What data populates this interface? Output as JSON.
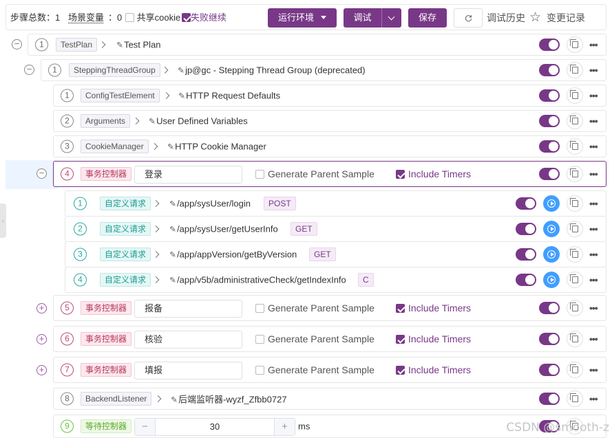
{
  "toolbar": {
    "steps_label": "步骤总数：1",
    "scene_vars_label": "场景变量",
    "scene_vars_count": "：0",
    "share_cookie_label": "共享cookie",
    "share_cookie_checked": false,
    "continue_on_fail_label": "失败继续",
    "continue_on_fail_checked": true,
    "run_env_label": "运行环境",
    "debug_label": "调试",
    "save_label": "保存",
    "refresh_icon": "refresh-icon",
    "debug_history_label": "调试历史",
    "change_log_label": "变更记录"
  },
  "accent_color": "#783887",
  "steps": {
    "test_plan": {
      "num": "1",
      "tag": "TestPlan",
      "name": "Test Plan"
    },
    "thread_group": {
      "num": "1",
      "tag": "SteppingThreadGroup",
      "name": "jp@gc - Stepping Thread Group (deprecated)"
    },
    "config": {
      "num": "1",
      "tag": "ConfigTestElement",
      "name": "HTTP Request Defaults"
    },
    "arguments": {
      "num": "2",
      "tag": "Arguments",
      "name": "User Defined Variables"
    },
    "cookie": {
      "num": "3",
      "tag": "CookieManager",
      "name": "HTTP Cookie Manager"
    },
    "tx_login": {
      "num": "4",
      "tag": "事务控制器",
      "name": "登录",
      "gen_parent_label": "Generate Parent Sample",
      "gen_parent_checked": false,
      "include_timers_label": "Include Timers",
      "include_timers_checked": true
    },
    "requests": [
      {
        "num": "1",
        "tag": "自定义请求",
        "path": "/app/sysUser/login",
        "method": "POST"
      },
      {
        "num": "2",
        "tag": "自定义请求",
        "path": "/app/sysUser/getUserInfo",
        "method": "GET"
      },
      {
        "num": "3",
        "tag": "自定义请求",
        "path": "/app/appVersion/getByVersion",
        "method": "GET"
      },
      {
        "num": "4",
        "tag": "自定义请求",
        "path": "/app/v5b/administrativeCheck/getIndexInfo",
        "method": "C"
      }
    ],
    "tx_report": {
      "num": "5",
      "tag": "事务控制器",
      "name": "报备",
      "gen_parent_label": "Generate Parent Sample",
      "gen_parent_checked": false,
      "include_timers_label": "Include Timers",
      "include_timers_checked": true
    },
    "tx_verify": {
      "num": "6",
      "tag": "事务控制器",
      "name": "核验",
      "gen_parent_label": "Generate Parent Sample",
      "gen_parent_checked": false,
      "include_timers_label": "Include Timers",
      "include_timers_checked": true
    },
    "tx_fill": {
      "num": "7",
      "tag": "事务控制器",
      "name": "填报",
      "gen_parent_label": "Generate Parent Sample",
      "gen_parent_checked": false,
      "include_timers_label": "Include Timers",
      "include_timers_checked": true
    },
    "backend": {
      "num": "8",
      "tag": "BackendListener",
      "name": "后端监听器-wyzf_Zfbb0727"
    },
    "wait": {
      "num": "9",
      "tag": "等待控制器",
      "value": "30",
      "unit": "ms",
      "minus": "−",
      "plus": "+"
    }
  },
  "icons": {
    "collapse": "−",
    "expand": "+",
    "edit": "✎",
    "more": "•••",
    "star": "☆"
  },
  "watermark": "CSDN @smooth-z"
}
